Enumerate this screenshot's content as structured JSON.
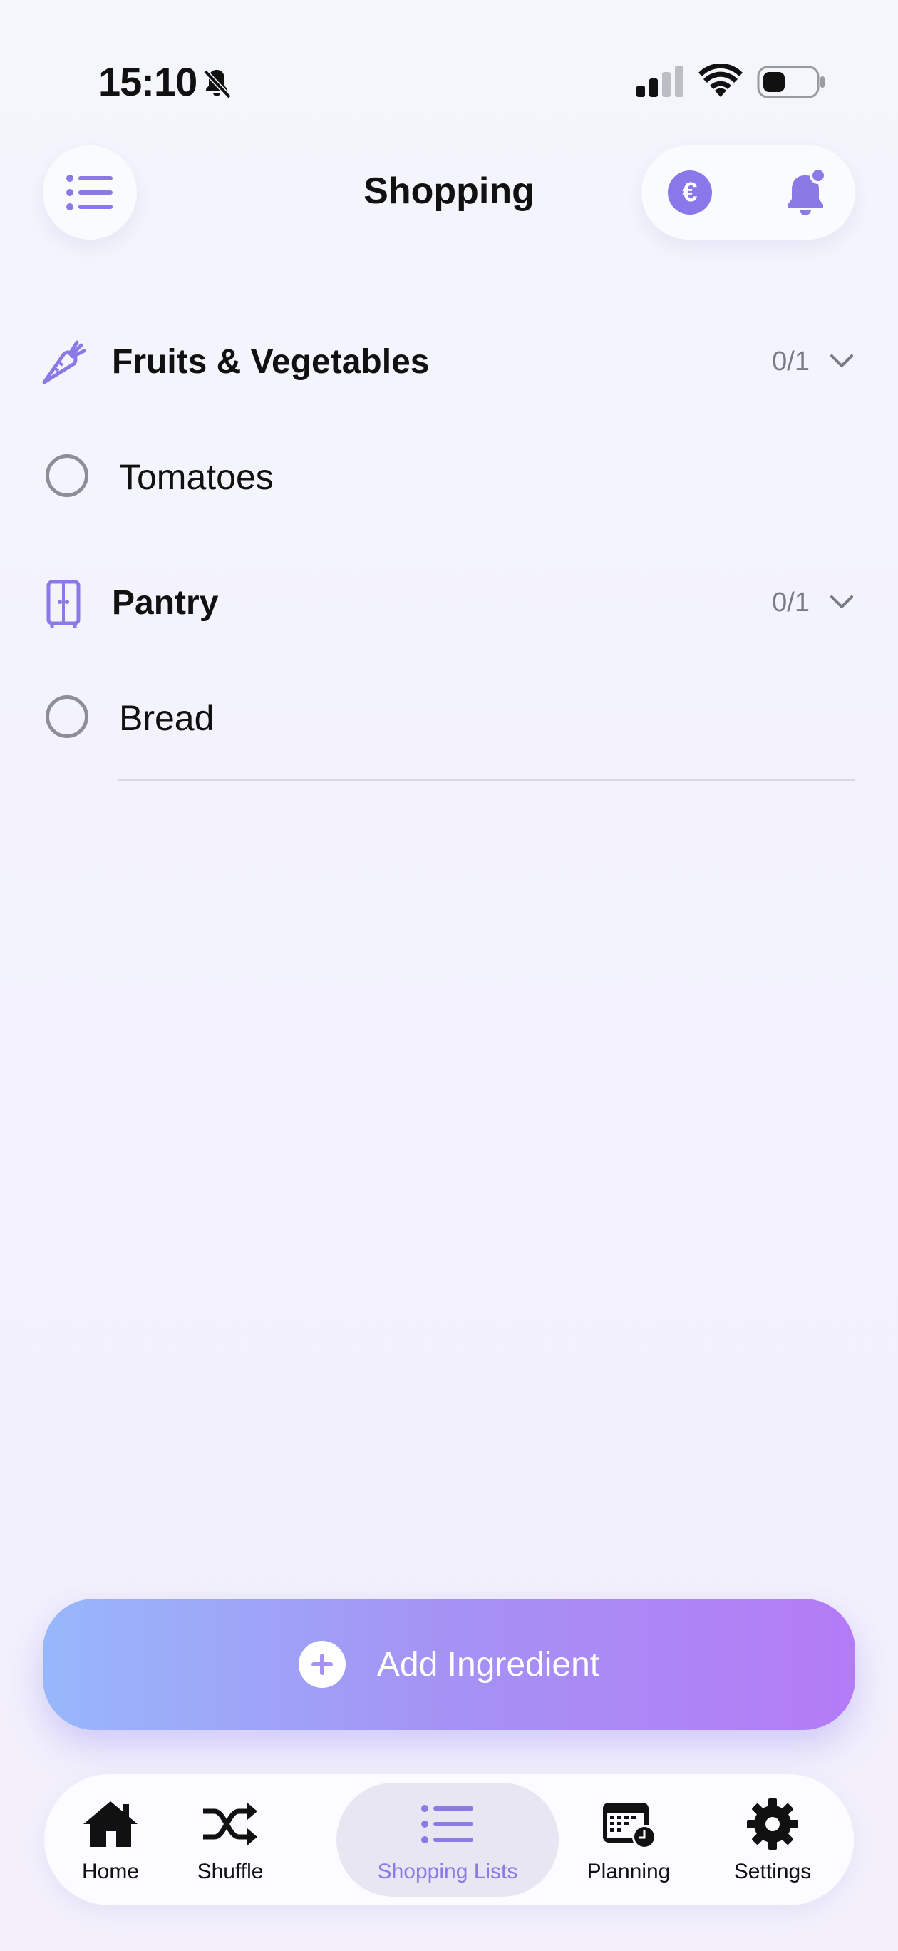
{
  "status_bar": {
    "time": "15:10"
  },
  "header": {
    "title": "Shopping",
    "currency_symbol": "€"
  },
  "sections": [
    {
      "title": "Fruits & Vegetables",
      "count": "0/1",
      "items": [
        {
          "label": "Tomatoes",
          "checked": false
        }
      ]
    },
    {
      "title": "Pantry",
      "count": "0/1",
      "items": [
        {
          "label": "Bread",
          "checked": false
        }
      ]
    }
  ],
  "add_button": {
    "label": "Add Ingredient"
  },
  "tabs": [
    {
      "label": "Home",
      "icon": "house-icon"
    },
    {
      "label": "Shuffle",
      "icon": "shuffle-icon"
    },
    {
      "label": "Shopping Lists",
      "icon": "list-icon",
      "active": true
    },
    {
      "label": "Planning",
      "icon": "calendar-clock-icon"
    },
    {
      "label": "Settings",
      "icon": "gear-icon"
    }
  ],
  "colors": {
    "accent": "#8b7ae6",
    "gradient_start": "#97b7fb",
    "gradient_end": "#b47bf6"
  }
}
